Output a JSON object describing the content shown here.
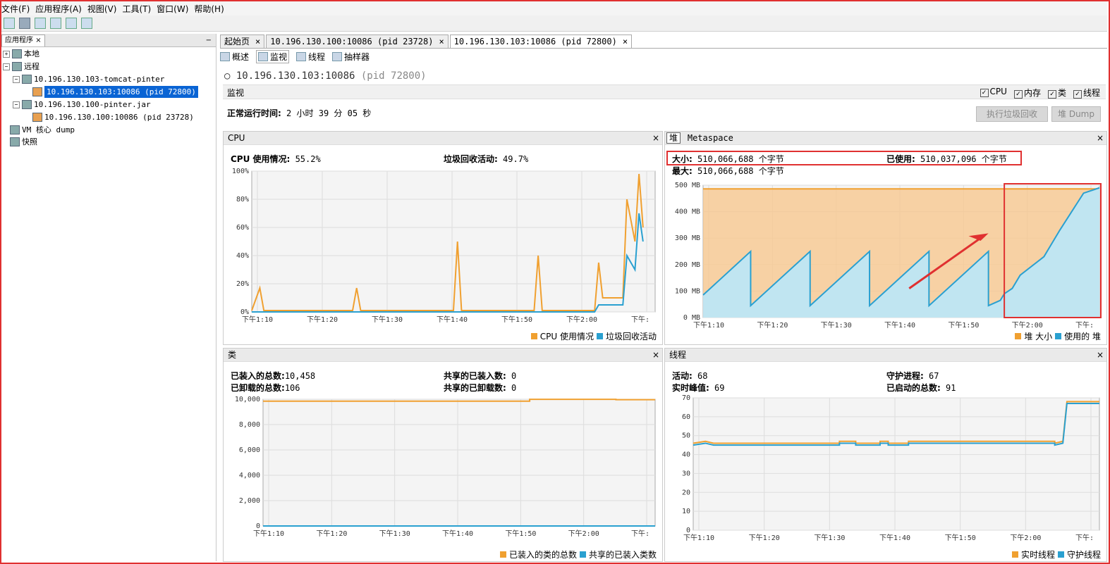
{
  "menu": [
    "文件(F)",
    "应用程序(A)",
    "视图(V)",
    "工具(T)",
    "窗口(W)",
    "帮助(H)"
  ],
  "left": {
    "tab_label": "应用程序",
    "tab_close": "×",
    "minimize": "−",
    "tree": [
      "本地",
      "远程",
      "10.196.130.103-tomcat-pinter",
      "10.196.130.103:10086 (pid 72800)",
      "10.196.130.100-pinter.jar",
      "10.196.130.100:10086 (pid 23728)",
      "VM 核心 dump",
      "快照"
    ]
  },
  "tabs": [
    {
      "label": "起始页",
      "close": "×"
    },
    {
      "label": "10.196.130.100:10086 (pid 23728)",
      "close": "×"
    },
    {
      "label": "10.196.130.103:10086 (pid 72800)",
      "close": "×"
    }
  ],
  "subtabs": [
    "概述",
    "监视",
    "线程",
    "抽样器"
  ],
  "header": {
    "host": "10.196.130.103:10086",
    "pid": "(pid 72800)"
  },
  "monitor": {
    "title": "监视",
    "checks": [
      "CPU",
      "内存",
      "类",
      "线程"
    ],
    "uptime_label": "正常运行时间:",
    "uptime_value": "2 小时 39 分 05 秒",
    "gc_button": "执行垃圾回收",
    "dump_button": "堆 Dump"
  },
  "cpu_panel": {
    "title": "CPU",
    "close": "×",
    "usage_label": "CPU 使用情况:",
    "usage_value": "55.2%",
    "gc_label": "垃圾回收活动:",
    "gc_value": "49.7%",
    "legend": [
      "CPU 使用情况",
      "垃圾回收活动"
    ]
  },
  "heap_panel": {
    "tab_heap": "堆",
    "tab_meta": "Metaspace",
    "close": "×",
    "size_label": "大小:",
    "size_value": "510,066,688 个字节",
    "used_label": "已使用:",
    "used_value": "510,037,096 个字节",
    "max_label": "最大:",
    "max_value": "510,066,688 个字节",
    "legend": [
      "堆 大小",
      "使用的 堆"
    ]
  },
  "classes_panel": {
    "title": "类",
    "close": "×",
    "loaded_label": "已装入的总数:",
    "loaded_value": "10,458",
    "shared_loaded_label": "共享的已装入数:",
    "shared_loaded_value": "0",
    "unloaded_label": "已卸载的总数:",
    "unloaded_value": "106",
    "shared_unloaded_label": "共享的已卸载数:",
    "shared_unloaded_value": "0",
    "legend": [
      "已装入的类的总数",
      "共享的已装入类数"
    ]
  },
  "threads_panel": {
    "title": "线程",
    "close": "×",
    "live_label": "活动:",
    "live_value": "68",
    "daemon_label": "守护进程:",
    "daemon_value": "67",
    "peak_label": "实时峰值:",
    "peak_value": "69",
    "started_label": "已启动的总数:",
    "started_value": "91",
    "legend": [
      "实时线程",
      "守护线程"
    ]
  },
  "time_ticks": [
    "下午1:10",
    "下午1:20",
    "下午1:30",
    "下午1:40",
    "下午1:50",
    "下午2:00",
    "下午:"
  ],
  "colors": {
    "orange": "#f0a030",
    "blue": "#2aa0d0",
    "select": "#0a64d4",
    "highlight": "#e03030"
  },
  "chart_data": [
    {
      "type": "line",
      "name": "CPU",
      "x": [
        "下午1:10",
        "下午1:20",
        "下午1:30",
        "下午1:40",
        "下午1:50",
        "下午2:00",
        "下午:"
      ],
      "yticks": [
        "100%",
        "80%",
        "60%",
        "40%",
        "20%",
        "0%"
      ],
      "ylim": [
        0,
        100
      ],
      "series": [
        {
          "name": "CPU 使用情况",
          "points": [
            [
              0,
              1
            ],
            [
              2,
              17
            ],
            [
              3,
              1
            ],
            [
              25,
              1
            ],
            [
              26,
              17
            ],
            [
              27,
              1
            ],
            [
              50,
              1
            ],
            [
              51,
              50
            ],
            [
              52,
              1
            ],
            [
              70,
              1
            ],
            [
              71,
              40
            ],
            [
              72,
              1
            ],
            [
              85,
              1
            ],
            [
              86,
              35
            ],
            [
              87,
              10
            ],
            [
              92,
              10
            ],
            [
              93,
              80
            ],
            [
              95,
              50
            ],
            [
              96,
              98
            ],
            [
              97,
              60
            ]
          ]
        },
        {
          "name": "垃圾回收活动",
          "points": [
            [
              0,
              0
            ],
            [
              85,
              0
            ],
            [
              86,
              5
            ],
            [
              92,
              5
            ],
            [
              93,
              40
            ],
            [
              95,
              30
            ],
            [
              96,
              70
            ],
            [
              97,
              50
            ]
          ]
        }
      ]
    },
    {
      "type": "area",
      "name": "堆",
      "yticks": [
        "500 MB",
        "400 MB",
        "300 MB",
        "200 MB",
        "100 MB",
        "0 MB"
      ],
      "ylim": [
        0,
        500
      ],
      "series": [
        {
          "name": "堆 大小",
          "points": [
            [
              0,
              486
            ],
            [
              100,
              486
            ]
          ]
        },
        {
          "name": "使用的 堆",
          "points": [
            [
              0,
              85
            ],
            [
              12,
              250
            ],
            [
              12,
              45
            ],
            [
              27,
              250
            ],
            [
              27,
              45
            ],
            [
              42,
              250
            ],
            [
              42,
              45
            ],
            [
              57,
              250
            ],
            [
              57,
              45
            ],
            [
              72,
              250
            ],
            [
              72,
              45
            ],
            [
              75,
              65
            ],
            [
              76,
              90
            ],
            [
              78,
              110
            ],
            [
              80,
              160
            ],
            [
              86,
              230
            ],
            [
              90,
              330
            ],
            [
              96,
              470
            ],
            [
              100,
              490
            ]
          ]
        }
      ]
    },
    {
      "type": "line",
      "name": "类",
      "yticks": [
        "10,000",
        "8,000",
        "6,000",
        "4,000",
        "2,000",
        "0"
      ],
      "ylim": [
        0,
        10458
      ],
      "series": [
        {
          "name": "已装入的类的总数",
          "points": [
            [
              0,
              10300
            ],
            [
              68,
              10300
            ],
            [
              68,
              10450
            ],
            [
              90,
              10450
            ],
            [
              90,
              10420
            ],
            [
              100,
              10420
            ]
          ]
        },
        {
          "name": "共享的已装入类数",
          "points": [
            [
              0,
              0
            ],
            [
              100,
              0
            ]
          ]
        }
      ]
    },
    {
      "type": "line",
      "name": "线程",
      "yticks": [
        "70",
        "60",
        "50",
        "40",
        "30",
        "20",
        "10",
        "0"
      ],
      "ylim": [
        0,
        70
      ],
      "series": [
        {
          "name": "实时线程",
          "points": [
            [
              0,
              46
            ],
            [
              3,
              47
            ],
            [
              5,
              46
            ],
            [
              36,
              46
            ],
            [
              36,
              47
            ],
            [
              40,
              47
            ],
            [
              40,
              46
            ],
            [
              46,
              46
            ],
            [
              46,
              47
            ],
            [
              48,
              47
            ],
            [
              48,
              46
            ],
            [
              53,
              46
            ],
            [
              53,
              47
            ],
            [
              89,
              47
            ],
            [
              89,
              46
            ],
            [
              91,
              47
            ],
            [
              92,
              68
            ],
            [
              100,
              68
            ]
          ]
        },
        {
          "name": "守护线程",
          "points": [
            [
              0,
              45
            ],
            [
              3,
              46
            ],
            [
              5,
              45
            ],
            [
              36,
              45
            ],
            [
              36,
              46
            ],
            [
              40,
              46
            ],
            [
              40,
              45
            ],
            [
              46,
              45
            ],
            [
              46,
              46
            ],
            [
              48,
              46
            ],
            [
              48,
              45
            ],
            [
              53,
              45
            ],
            [
              53,
              46
            ],
            [
              89,
              46
            ],
            [
              89,
              45
            ],
            [
              91,
              46
            ],
            [
              92,
              67
            ],
            [
              100,
              67
            ]
          ]
        }
      ]
    }
  ]
}
